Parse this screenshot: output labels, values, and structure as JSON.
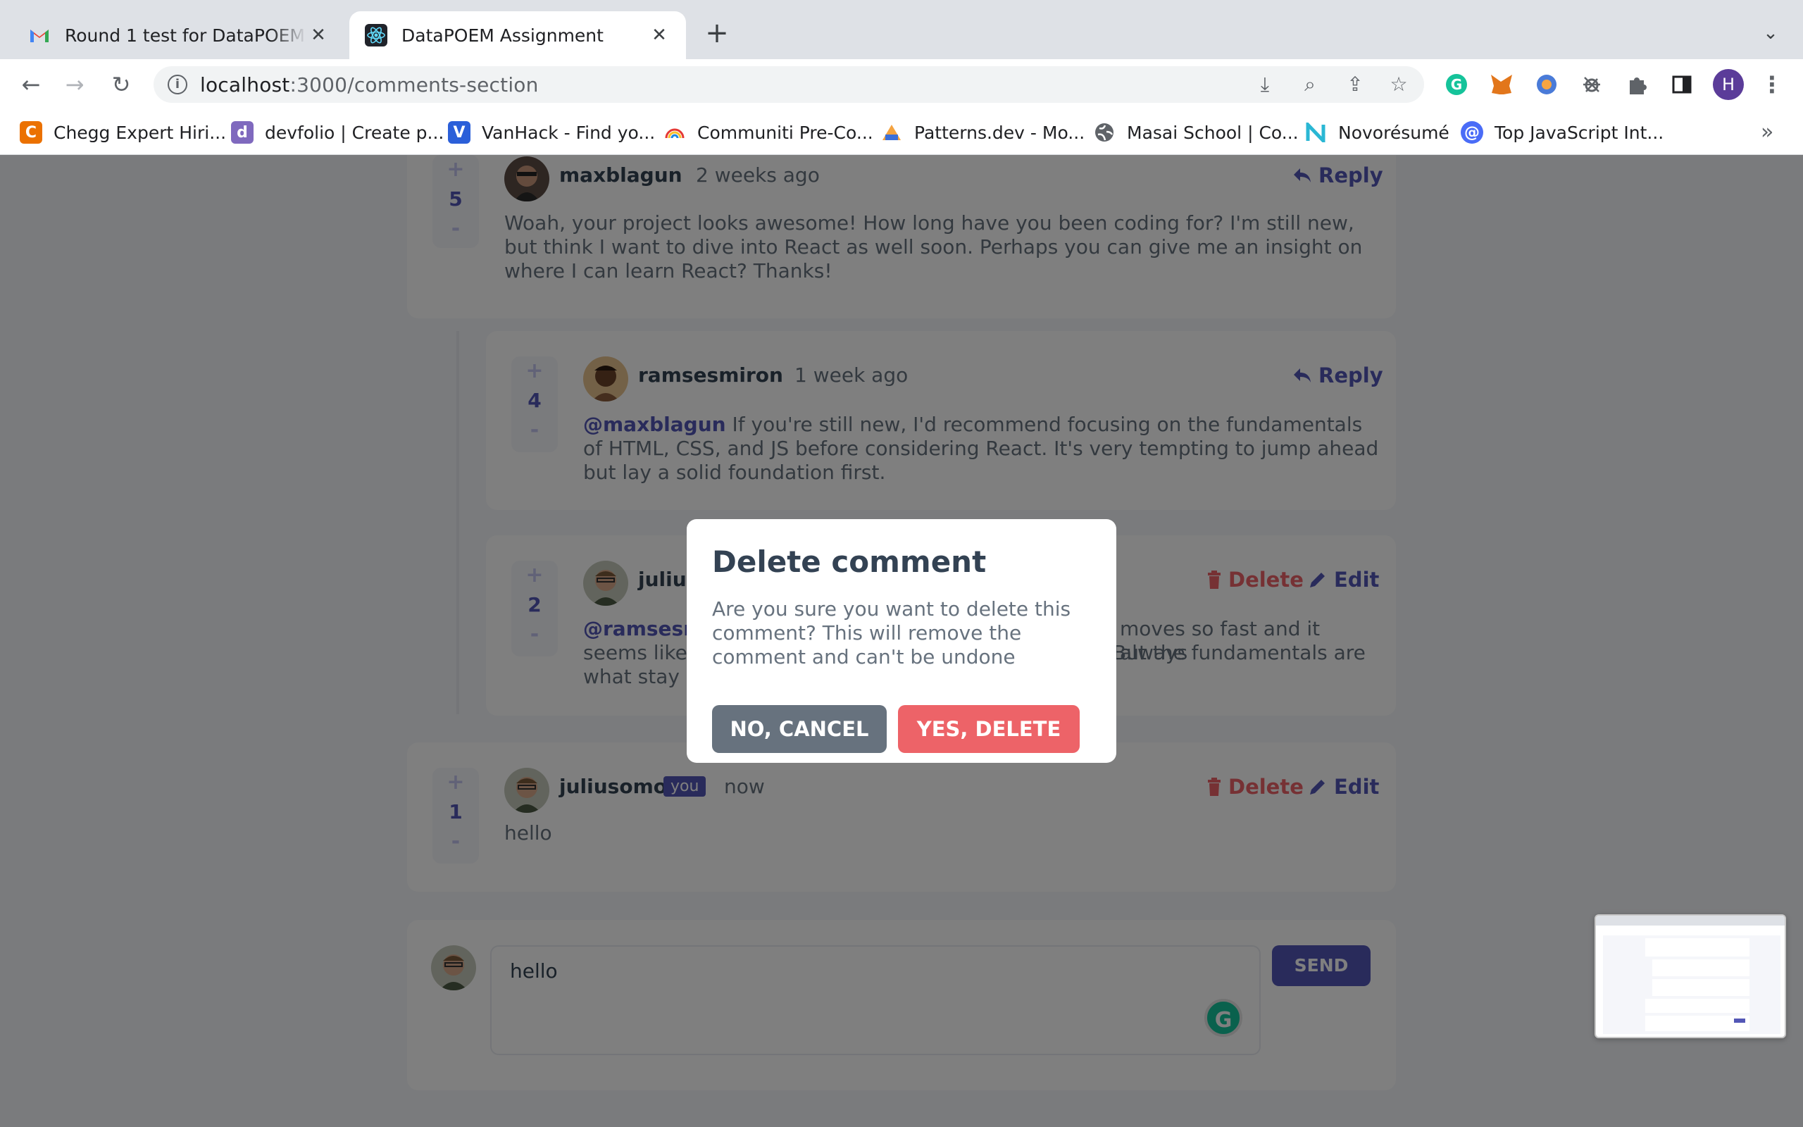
{
  "browser": {
    "tabs": [
      {
        "title": "Round 1 test for DataPOEM - h",
        "icon": "gmail-icon",
        "active": false
      },
      {
        "title": "DataPOEM Assignment",
        "icon": "react-icon",
        "active": true
      }
    ],
    "new_tab_label": "+",
    "url_host": "localhost",
    "url_path": ":3000/comments-section",
    "profile_initial": "H",
    "bookmarks": [
      {
        "label": "Chegg Expert Hiri...",
        "icon": "chegg-icon",
        "badge": "C",
        "color": "#eb7100"
      },
      {
        "label": "devfolio | Create p...",
        "icon": "devfolio-icon",
        "badge": "d",
        "color": "#7f69be"
      },
      {
        "label": "VanHack - Find yo...",
        "icon": "vanhack-icon",
        "badge": "V",
        "color": "#2b5fd9"
      },
      {
        "label": "Communiti Pre-Co...",
        "icon": "rainbow-icon",
        "badge": "",
        "color": "#ffffff"
      },
      {
        "label": "Patterns.dev - Mo...",
        "icon": "patterns-icon",
        "badge": "",
        "color": "#ffffff"
      },
      {
        "label": "Masai School | Co...",
        "icon": "globe-icon",
        "badge": "",
        "color": "#5f6368"
      },
      {
        "label": "Novorésumé",
        "icon": "novoresume-icon",
        "badge": "N",
        "color": "#ffffff"
      },
      {
        "label": "Top JavaScript Int...",
        "icon": "at-icon",
        "badge": "@",
        "color": "#4a6cf7"
      }
    ],
    "bookmarks_overflow": "»"
  },
  "comments": [
    {
      "id": "c1",
      "user": "maxblagun",
      "time": "2 weeks ago",
      "score": "5",
      "action": "Reply",
      "text": "Woah, your project looks awesome! How long have you been coding for? I'm still new, but think I want to dive into React as well soon. Perhaps you can give me an insight on where I can learn React? Thanks!"
    },
    {
      "id": "c2",
      "user": "ramsesmiron",
      "time": "1 week ago",
      "score": "4",
      "action": "Reply",
      "mention": "@maxblagun",
      "text": " If you're still new, I'd recommend focusing on the fundamentals of HTML, CSS, and JS before considering React. It's very tempting to jump ahead but lay a solid foundation first."
    },
    {
      "id": "c3",
      "user": "julius",
      "score": "2",
      "delete_label": "Delete",
      "edit_label": "Edit",
      "mention": "@ramsesm",
      "line1_right": "moves so fast and it always",
      "line2_left": "seems like c",
      "line2_right": "But the fundamentals are",
      "line3_left": "what stay c"
    },
    {
      "id": "c4",
      "user": "juliusomo",
      "you_badge": "you",
      "time": "now",
      "score": "1",
      "delete_label": "Delete",
      "edit_label": "Edit",
      "text": "hello"
    }
  ],
  "vote_plus": "+",
  "vote_minus": "-",
  "composer": {
    "value": "hello",
    "send_label": "SEND",
    "grammarly_label": "G"
  },
  "modal": {
    "title": "Delete comment",
    "body": "Are you sure you want to delete this comment? This will remove the comment and can't be undone",
    "cancel_label": "NO, CANCEL",
    "confirm_label": "YES, DELETE"
  },
  "colors": {
    "primary": "#5357b6",
    "danger": "#ed6368",
    "neutral_button": "#67727e",
    "overlay": "rgba(0,0,0,0.5)"
  }
}
